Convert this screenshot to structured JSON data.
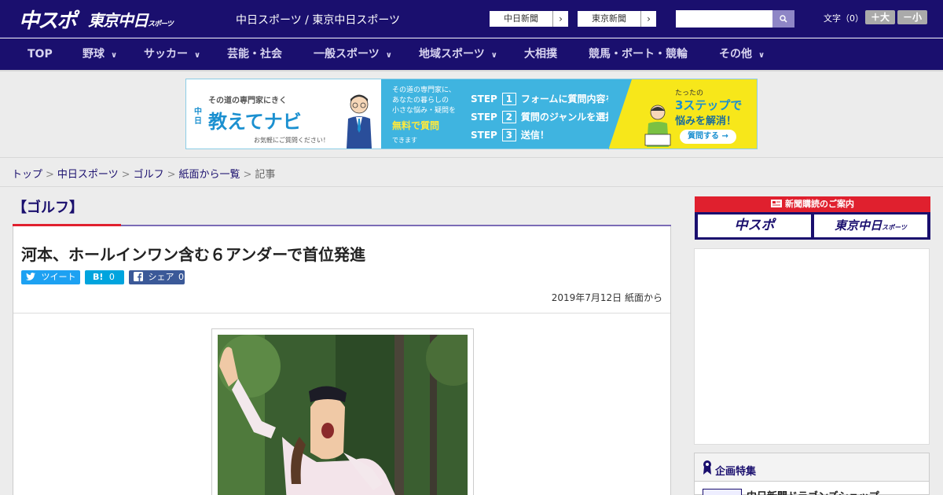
{
  "header": {
    "logo_primary": "中スポ",
    "logo_secondary": "東京中日",
    "logo_secondary_small": "スポーツ",
    "site_text": "中日スポーツ / 東京中日スポーツ",
    "paper_links": [
      {
        "label": "中日新聞",
        "arrow": "›"
      },
      {
        "label": "東京新聞",
        "arrow": "›"
      }
    ],
    "search": {
      "placeholder": "",
      "button_icon": "search-icon",
      "button_glyph": "⚲"
    },
    "font_size": {
      "label": "文字（0）",
      "plus": "＋大",
      "minus": "－小"
    }
  },
  "nav": {
    "items": [
      {
        "label": "TOP",
        "has_menu": false
      },
      {
        "label": "野球",
        "has_menu": true
      },
      {
        "label": "サッカー",
        "has_menu": true
      },
      {
        "label": "芸能・社会",
        "has_menu": false
      },
      {
        "label": "一般スポーツ",
        "has_menu": true
      },
      {
        "label": "地域スポーツ",
        "has_menu": true
      },
      {
        "label": "大相撲",
        "has_menu": false
      },
      {
        "label": "競馬・ボート・競輪",
        "has_menu": false
      },
      {
        "label": "その他",
        "has_menu": true
      }
    ],
    "chevron": "∨"
  },
  "banner": {
    "tagline": "その道の専門家にきく",
    "brand_prefix": "中日",
    "title": "教えてナビ",
    "note": "お気軽にご質問ください！",
    "mid_text": [
      "その道の専門家に、",
      "あなたの暮らしの",
      "小さな悩み・疑問を"
    ],
    "mid_highlight": "無料で質問",
    "mid_end": "できます",
    "steps": [
      {
        "prefix": "STEP",
        "num": "1",
        "text": "フォームに質問内容を入力"
      },
      {
        "prefix": "STEP",
        "num": "2",
        "text": "質問のジャンルを選択"
      },
      {
        "prefix": "STEP",
        "num": "3",
        "text": "送信！"
      }
    ],
    "right_small": "たったの",
    "right_big": "3ステップで",
    "right_sub": "悩みを解消！",
    "right_button": "質問する →"
  },
  "breadcrumb": {
    "items": [
      "トップ",
      "中日スポーツ",
      "ゴルフ",
      "紙面から一覧"
    ],
    "current": "記事",
    "separator": ">"
  },
  "article": {
    "category": "【ゴルフ】",
    "headline": "河本、ホールインワン含む６アンダーで首位発進",
    "share": {
      "tweet": "ツイート",
      "hatena_label": "B!",
      "hatena_count": "0",
      "facebook_label": "シェア",
      "facebook_count": "0"
    },
    "dateline": "2019年7月12日 紙面から"
  },
  "sidebar": {
    "subscribe_title": "新聞購読のご案内",
    "subscribe_buttons": [
      "中スポ",
      "東京中日"
    ],
    "subscribe_small": "スポーツ",
    "feature_title": "企画特集",
    "feature_item": "中日新聞ドラゴンズショップ"
  },
  "colors": {
    "brand_navy": "#1a0f6e",
    "accent_red": "#e0202e",
    "accent_purple": "#7b6bb6",
    "twitter": "#1da1f2",
    "hatena": "#00a4de",
    "facebook": "#3b5998"
  }
}
